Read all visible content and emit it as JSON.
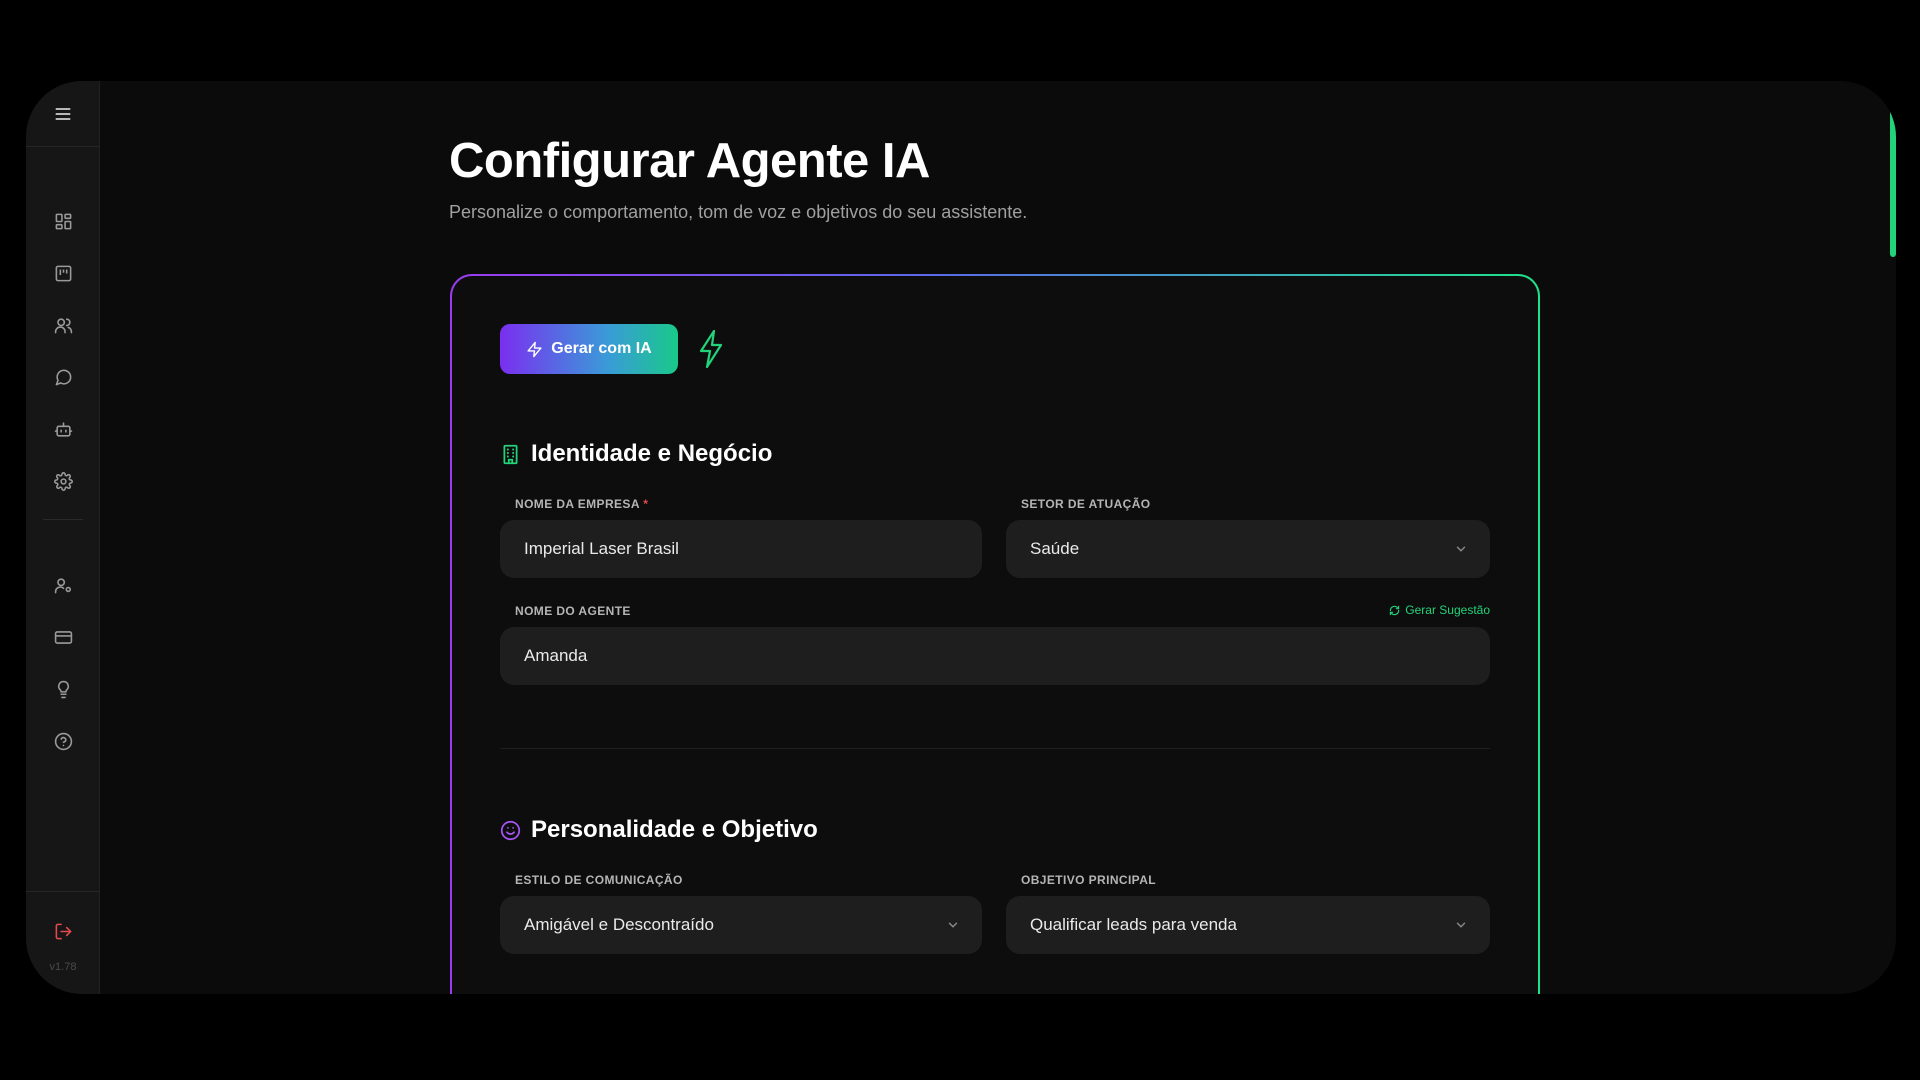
{
  "sidebar": {
    "menu_icon": "menu-icon",
    "items": [
      {
        "name": "dashboard",
        "icon": "grid-icon"
      },
      {
        "name": "kanban",
        "icon": "board-icon"
      },
      {
        "name": "contacts",
        "icon": "users-icon"
      },
      {
        "name": "chat",
        "icon": "message-icon"
      },
      {
        "name": "agent",
        "icon": "bot-icon"
      },
      {
        "name": "settings",
        "icon": "gear-icon"
      },
      {
        "name": "user-settings",
        "icon": "user-cog-icon"
      },
      {
        "name": "billing",
        "icon": "credit-card-icon"
      },
      {
        "name": "ideas",
        "icon": "lightbulb-icon"
      },
      {
        "name": "help",
        "icon": "help-circle-icon"
      }
    ],
    "logout_icon": "logout-icon",
    "version": "v1.78"
  },
  "page": {
    "title": "Configurar Agente IA",
    "subtitle": "Personalize o comportamento, tom de voz e objetivos do seu assistente."
  },
  "card": {
    "generate_button": "Gerar com IA",
    "section_identity": {
      "title": "Identidade e Negócio",
      "company_label": "NOME DA EMPRESA",
      "required_mark": "*",
      "company_value": "Imperial Laser Brasil",
      "sector_label": "SETOR DE ATUAÇÃO",
      "sector_value": "Saúde",
      "agent_label": "NOME DO AGENTE",
      "suggest_link": "Gerar Sugestão",
      "agent_value": "Amanda"
    },
    "section_personality": {
      "title": "Personalidade e Objetivo",
      "style_label": "ESTILO DE COMUNICAÇÃO",
      "style_value": "Amigável e Descontraído",
      "goal_label": "OBJETIVO PRINCIPAL",
      "goal_value": "Qualificar leads para venda"
    }
  },
  "colors": {
    "accent_green": "#22d37a",
    "accent_purple": "#9b3cf0",
    "background": "#0b0b0b",
    "field_bg": "#1e1e1e"
  }
}
